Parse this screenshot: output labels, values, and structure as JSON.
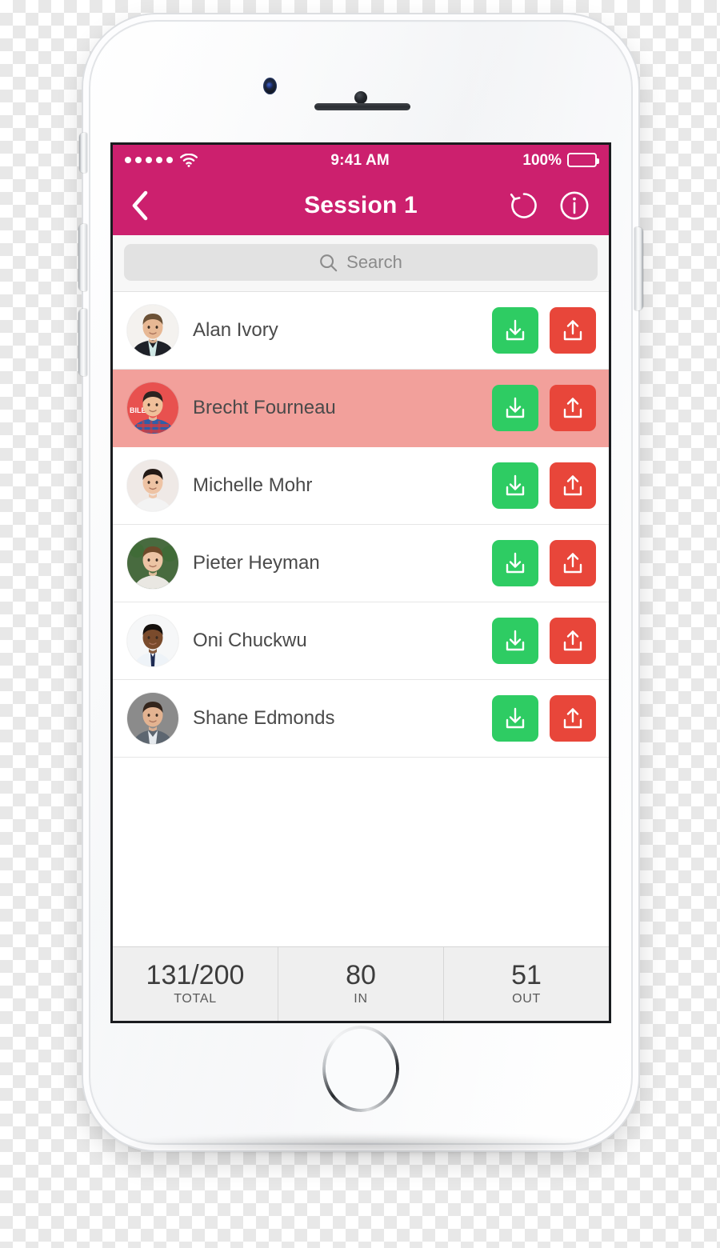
{
  "status_bar": {
    "signal_dots": 5,
    "wifi_icon": "wifi-icon",
    "time": "9:41 AM",
    "battery_percent": "100%",
    "battery_icon": "battery-full-icon"
  },
  "nav_bar": {
    "back_icon": "chevron-left-icon",
    "title": "Session 1",
    "reset_icon": "reset-counterclockwise-icon",
    "info_icon": "info-circle-icon"
  },
  "search": {
    "icon": "search-icon",
    "placeholder": "Search",
    "value": ""
  },
  "people": [
    {
      "name": "Alan Ivory",
      "avatar": "avatar-alan-ivory",
      "highlighted": false,
      "check_in_label": "check-in",
      "check_out_label": "check-out"
    },
    {
      "name": "Brecht Fourneau",
      "avatar": "avatar-brecht-fourneau",
      "highlighted": true,
      "check_in_label": "check-in",
      "check_out_label": "check-out"
    },
    {
      "name": "Michelle Mohr",
      "avatar": "avatar-michelle-mohr",
      "highlighted": false,
      "check_in_label": "check-in",
      "check_out_label": "check-out"
    },
    {
      "name": "Pieter Heyman",
      "avatar": "avatar-pieter-heyman",
      "highlighted": false,
      "check_in_label": "check-in",
      "check_out_label": "check-out"
    },
    {
      "name": "Oni Chuckwu",
      "avatar": "avatar-oni-chuckwu",
      "highlighted": false,
      "check_in_label": "check-in",
      "check_out_label": "check-out"
    },
    {
      "name": "Shane Edmonds",
      "avatar": "avatar-shane-edmonds",
      "highlighted": false,
      "check_in_label": "check-in",
      "check_out_label": "check-out"
    }
  ],
  "stats": [
    {
      "value": "131/200",
      "label": "TOTAL"
    },
    {
      "value": "80",
      "label": "IN"
    },
    {
      "value": "51",
      "label": "OUT"
    }
  ],
  "colors": {
    "brand_magenta": "#CC206E",
    "check_in_green": "#2ECC63",
    "check_out_red": "#E8463A",
    "row_highlight": "#F2A09B",
    "footer_gray": "#EFEFEF",
    "search_field": "#E2E2E2",
    "name_text": "#4A4A4A"
  },
  "device": {
    "body_color": "#F2F3F5",
    "home_button": "home-button",
    "front_camera": "front-camera",
    "earpiece": "earpiece-speaker"
  }
}
